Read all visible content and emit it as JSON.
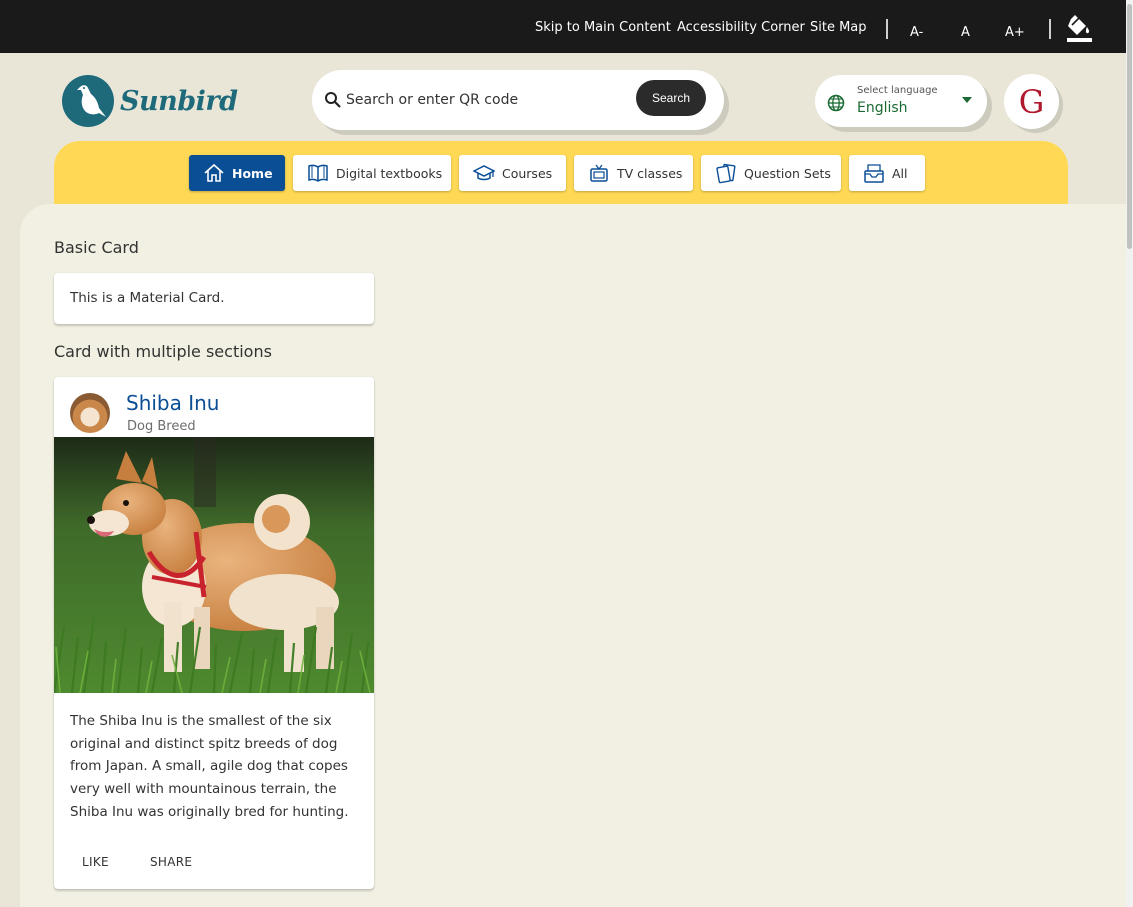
{
  "topbar": {
    "skip_link": "Skip to Main Content",
    "accessibility_link": "Accessibility Corner",
    "sitemap_link": "Site Map",
    "font_decrease": "A-",
    "font_normal": "A",
    "font_increase": "A+",
    "theme_icon": "paint-bucket-icon"
  },
  "header": {
    "logo_text": "Sunbird",
    "search": {
      "placeholder": "Search or enter QR code",
      "button_label": "Search"
    },
    "language": {
      "hint": "Select language",
      "value": "English"
    },
    "avatar_initial": "G"
  },
  "nav": {
    "items": [
      {
        "label": "Home",
        "icon": "home-icon",
        "active": true
      },
      {
        "label": "Digital textbooks",
        "icon": "book-icon"
      },
      {
        "label": "Courses",
        "icon": "graduation-cap-icon"
      },
      {
        "label": "TV classes",
        "icon": "tv-icon"
      },
      {
        "label": "Question Sets",
        "icon": "cards-icon"
      },
      {
        "label": "All",
        "icon": "inbox-icon"
      }
    ]
  },
  "main": {
    "basic_card": {
      "section_title": "Basic Card",
      "text": "This is a Material Card."
    },
    "multi_card": {
      "section_title": "Card with multiple sections",
      "title": "Shiba Inu",
      "subtitle": "Dog Breed",
      "body": "The Shiba Inu is the smallest of the six original and distinct spitz breeds of dog from Japan. A small, agile dog that copes very well with mountainous terrain, the Shiba Inu was originally bred for hunting.",
      "actions": {
        "like": "LIKE",
        "share": "SHARE"
      }
    }
  },
  "colors": {
    "topbar": "#1a1a1a",
    "accent_blue": "#0a4e96",
    "nav_yellow": "#ffd955",
    "brand_teal": "#1e6a7b",
    "language_green": "#1b6a33",
    "avatar_red": "#b0182e"
  }
}
